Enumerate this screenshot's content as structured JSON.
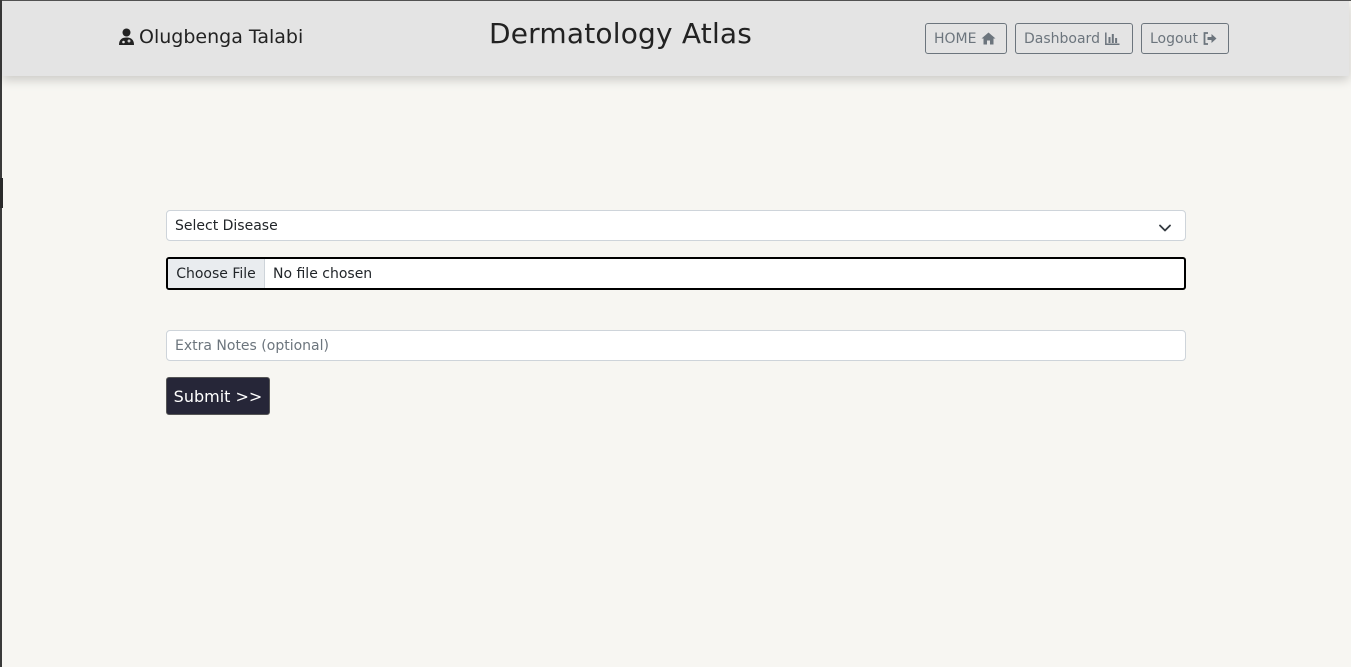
{
  "header": {
    "user_name": "Olugbenga Talabi",
    "site_title": "Dermatology Atlas",
    "nav": {
      "home_label": "HOME",
      "dashboard_label": "Dashboard",
      "logout_label": "Logout"
    },
    "icons": {
      "user": "user-doctor-icon",
      "home": "home-icon",
      "dashboard": "bar-chart-icon",
      "logout": "sign-out-icon"
    }
  },
  "form": {
    "disease_select": {
      "selected": "Select Disease"
    },
    "file_input": {
      "button_label": "Choose File",
      "status": "No file chosen"
    },
    "notes": {
      "placeholder": "Extra Notes (optional)",
      "value": ""
    },
    "submit_label": "Submit >>"
  },
  "colors": {
    "page_background": "#f7f6f2",
    "header_background": "#e4e4e4",
    "submit_background": "#262638",
    "nav_outline": "#6c757d"
  }
}
